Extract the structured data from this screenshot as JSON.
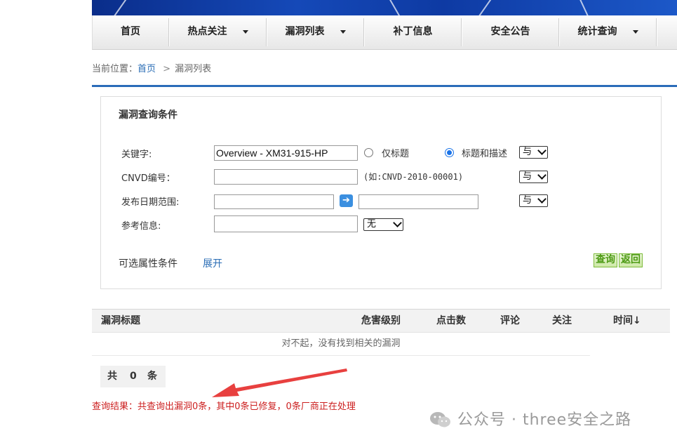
{
  "nav": {
    "items": [
      {
        "label": "首页",
        "dropdown": false
      },
      {
        "label": "热点关注",
        "dropdown": true
      },
      {
        "label": "漏洞列表",
        "dropdown": true
      },
      {
        "label": "补丁信息",
        "dropdown": false
      },
      {
        "label": "安全公告",
        "dropdown": false
      },
      {
        "label": "统计查询",
        "dropdown": true
      }
    ]
  },
  "breadcrumb": {
    "prefix": "当前位置：",
    "home": "首页",
    "separator": ">",
    "current": "漏洞列表"
  },
  "search": {
    "title": "漏洞查询条件",
    "keyword_label": "关键字:",
    "keyword_value": "Overview - XM31-915-HP",
    "radio_title_only": "仅标题",
    "radio_title_desc": "标题和描述",
    "radio_selected": "标题和描述",
    "cnvd_label": "CNVD编号：",
    "cnvd_value": "",
    "cnvd_hint": "(如:CNVD-2010-00001)",
    "date_label": "发布日期范围:",
    "date_from": "",
    "date_to": "",
    "ref_label": "参考信息:",
    "ref_value": "",
    "ref_select": "无",
    "logic_select_1": "与",
    "logic_select_2": "与",
    "logic_select_3": "与",
    "optional_label": "可选属性条件",
    "expand_link": "展开",
    "query_button": "查询",
    "back_button": "返回",
    "date_arrow": "➔"
  },
  "table": {
    "headers": [
      "漏洞标题",
      "危害级别",
      "点击数",
      "评论",
      "关注",
      "时间↓"
    ],
    "empty_message": "对不起，没有找到相关的漏洞"
  },
  "pager": {
    "prefix": "共",
    "count": "0",
    "suffix": "条"
  },
  "result_text": "查询结果：共查询出漏洞0条，其中0条已修复，0条厂商正在处理",
  "watermark": "公众号 · three安全之路",
  "colors": {
    "accent_blue": "#2b6cb9",
    "result_red": "#cc1f1f",
    "button_green": "#4c9a13",
    "annotation_arrow": "#e8403f"
  }
}
